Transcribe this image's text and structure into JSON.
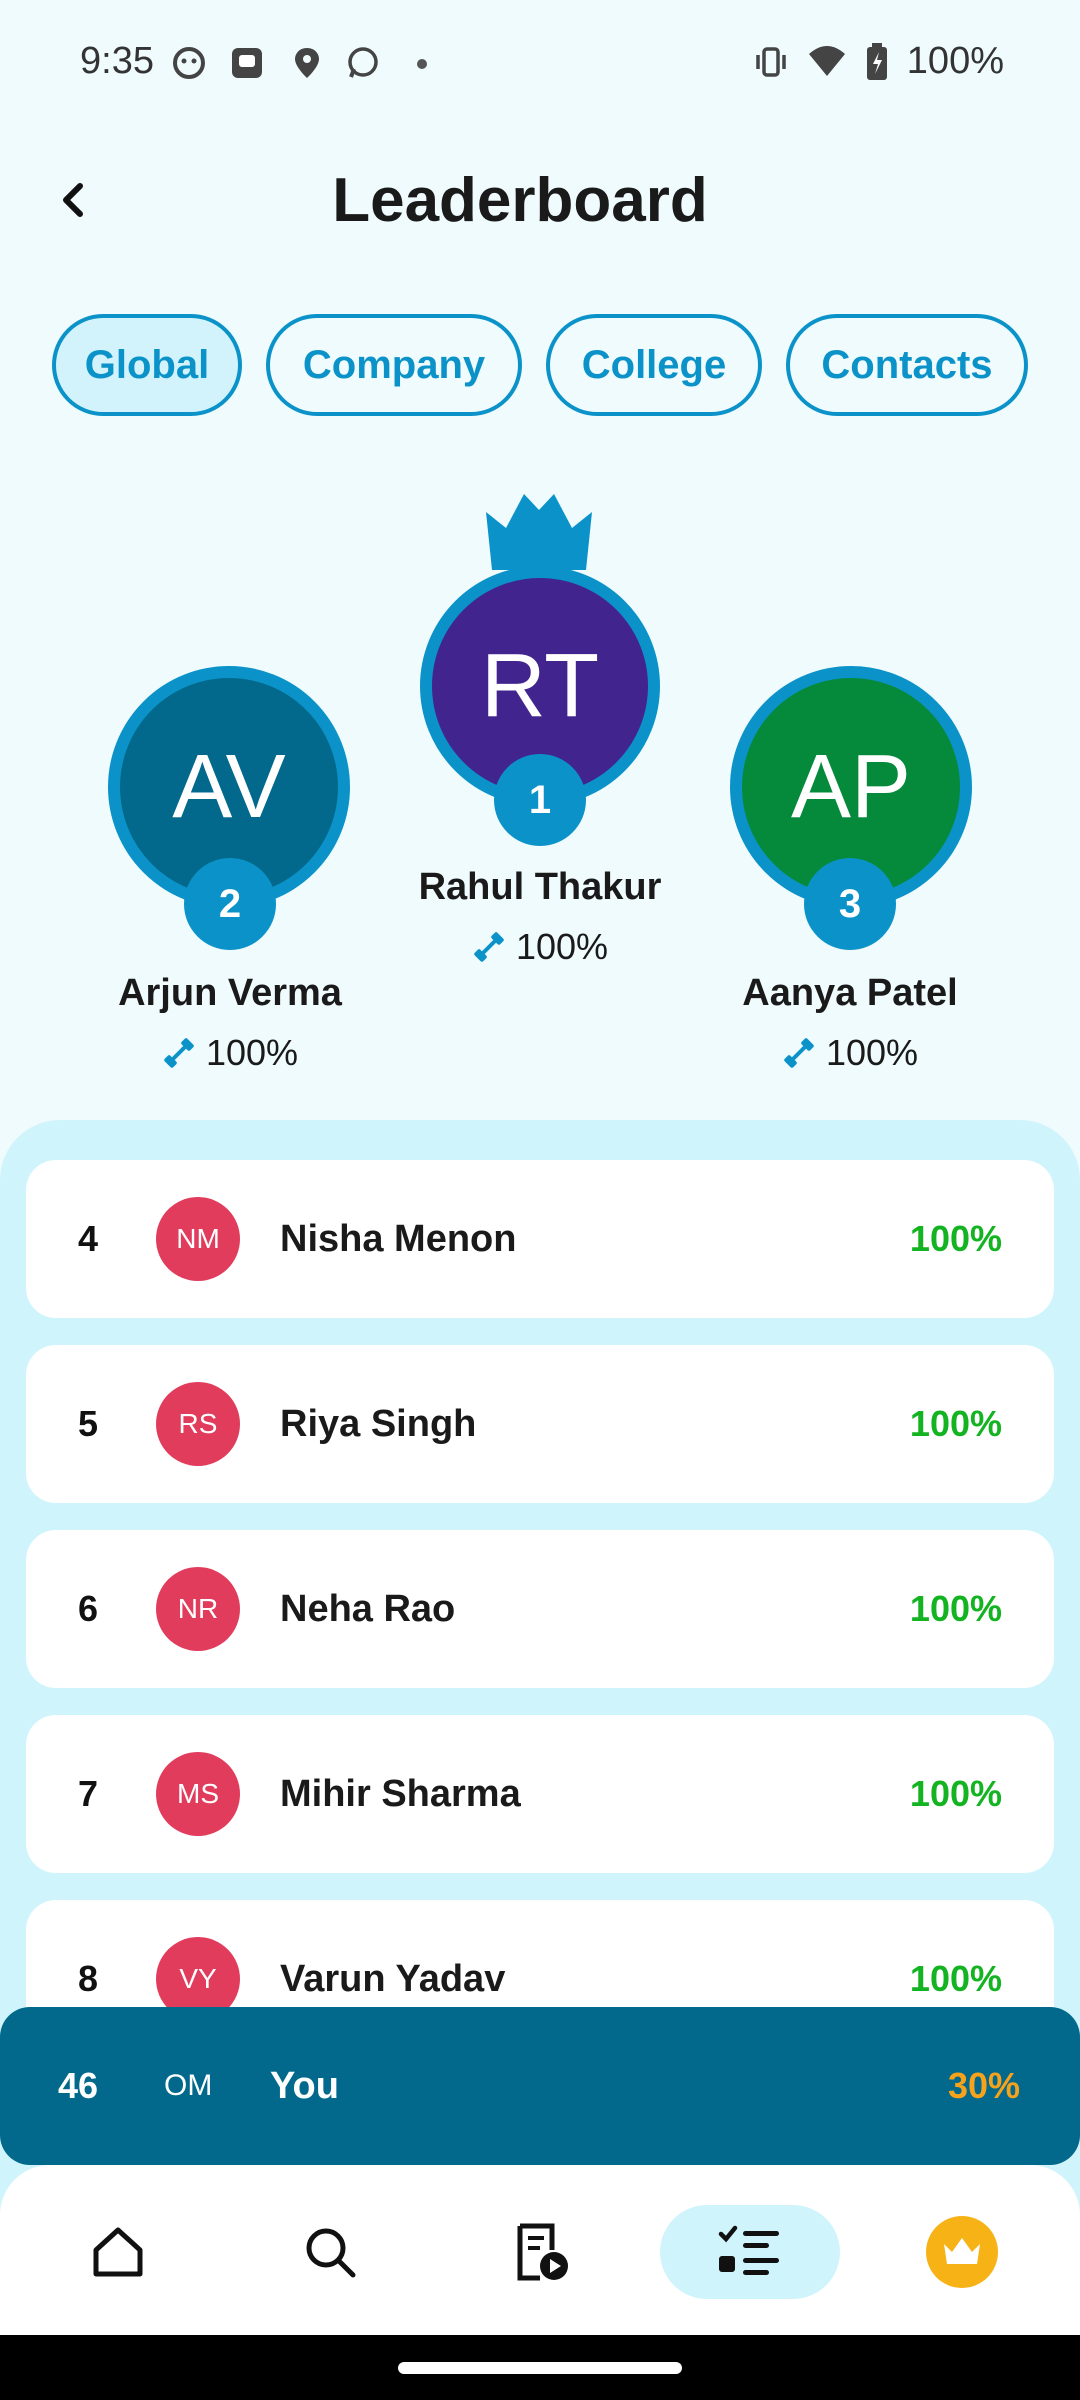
{
  "status_bar": {
    "time": "9:35",
    "battery": "100%"
  },
  "header": {
    "title": "Leaderboard"
  },
  "tabs": [
    {
      "label": "Global",
      "active": true
    },
    {
      "label": "Company",
      "active": false
    },
    {
      "label": "College",
      "active": false
    },
    {
      "label": "Contacts",
      "active": false
    }
  ],
  "podium": {
    "first": {
      "initials": "RT",
      "rank": "1",
      "name": "Rahul Thakur",
      "score": "100%",
      "color": "#42248f"
    },
    "second": {
      "initials": "AV",
      "rank": "2",
      "name": "Arjun Verma",
      "score": "100%",
      "color": "#02698c"
    },
    "third": {
      "initials": "AP",
      "rank": "3",
      "name": "Aanya Patel",
      "score": "100%",
      "color": "#058a3c"
    }
  },
  "list": [
    {
      "rank": "4",
      "initials": "NM",
      "name": "Nisha Menon",
      "score": "100%"
    },
    {
      "rank": "5",
      "initials": "RS",
      "name": "Riya Singh",
      "score": "100%"
    },
    {
      "rank": "6",
      "initials": "NR",
      "name": "Neha Rao",
      "score": "100%"
    },
    {
      "rank": "7",
      "initials": "MS",
      "name": "Mihir Sharma",
      "score": "100%"
    },
    {
      "rank": "8",
      "initials": "VY",
      "name": "Varun Yadav",
      "score": "100%"
    }
  ],
  "you": {
    "rank": "46",
    "initials": "OM",
    "name": "You",
    "score": "30%"
  },
  "nav": {
    "items": [
      "home-icon",
      "search-icon",
      "video-lessons-icon",
      "leaderboard-icon",
      "premium-crown-icon"
    ],
    "active": "leaderboard-icon"
  },
  "colors": {
    "accent": "#0b93c9",
    "score_green": "#13b321",
    "you_score": "#f7a21b",
    "you_bar": "#02698c"
  }
}
